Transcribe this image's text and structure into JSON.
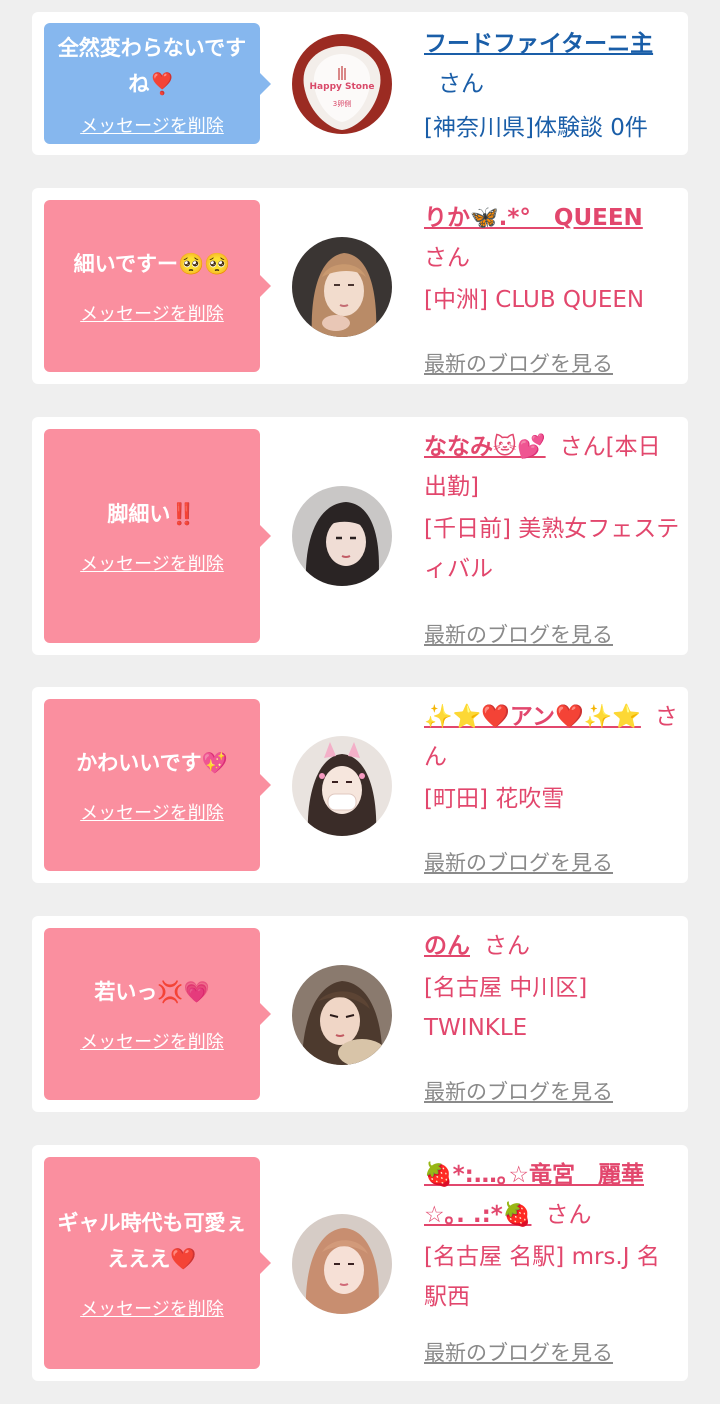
{
  "cards": [
    {
      "message": "全然変わらないですね❣️",
      "delete_label": "メッセージを削除",
      "name": "フードファイターニ主",
      "san": "さん",
      "shop": "[神奈川県]体験談 0件",
      "blog_label": "",
      "avatar_text": "Happy Stone",
      "avatar_sub": "3卵側"
    },
    {
      "message": "細いですー🥺🥺",
      "delete_label": "メッセージを削除",
      "name": "りか🦋.*°　QUEEN",
      "san": "さん",
      "shop": "[中洲] CLUB QUEEN",
      "blog_label": "最新のブログを見る"
    },
    {
      "message": "脚細い‼️",
      "delete_label": "メッセージを削除",
      "name": "ななみ🐱💕",
      "san": "さん[本日出勤]",
      "shop": "[千日前] 美熟女フェスティバル",
      "blog_label": "最新のブログを見る"
    },
    {
      "message": "かわいいです💖",
      "delete_label": "メッセージを削除",
      "name": "✨⭐️❤️アン❤️✨⭐️",
      "san": "さん",
      "shop": "[町田] 花吹雪",
      "blog_label": "最新のブログを見る"
    },
    {
      "message": "若いっ💢💗",
      "delete_label": "メッセージを削除",
      "name": "のん",
      "san": "さん",
      "shop": "[名古屋 中川区] TWINKLE",
      "blog_label": "最新のブログを見る"
    },
    {
      "message": "ギャル時代も可愛ぇえええ❤️",
      "delete_label": "メッセージを削除",
      "name": "🍓*:…｡☆竜宮　麗華☆｡. .:*🍓",
      "san": "さん",
      "shop": "[名古屋 名駅] mrs.J 名駅西",
      "blog_label": "最新のブログを見る"
    }
  ],
  "colors": {
    "background": "#efefef",
    "card": "#ffffff",
    "bubble_pink": "#fa8f9f",
    "bubble_blue": "#86b7ee",
    "name_pink": "#e2476d",
    "name_blue": "#1a5ea8",
    "blog_gray": "#8a8a8a"
  }
}
